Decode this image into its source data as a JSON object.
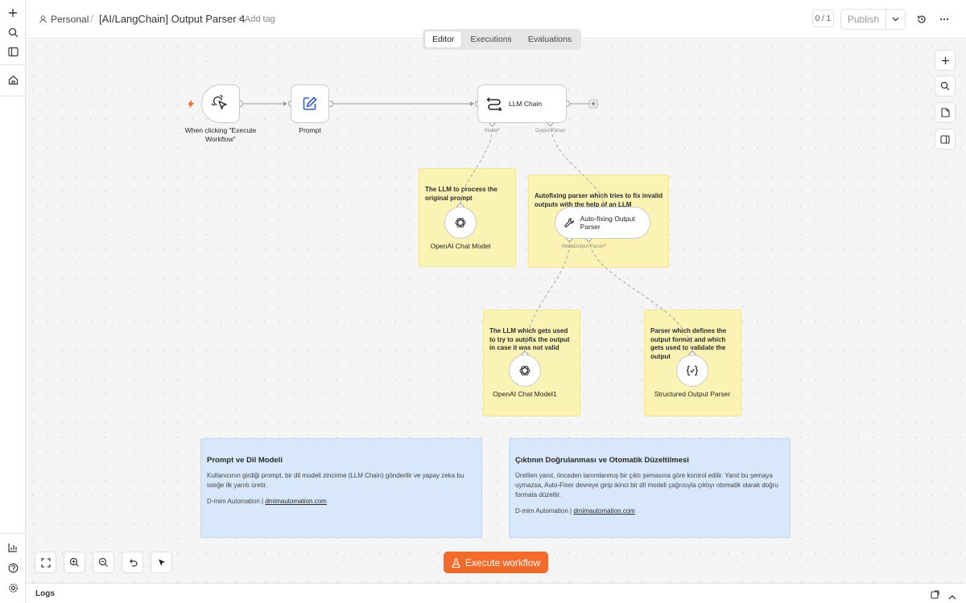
{
  "header": {
    "project": "Personal",
    "separator": "/",
    "workflow_title": "[AI/LangChain] Output Parser 4",
    "add_tag": "+ Add tag",
    "counter": "0 / 1",
    "publish": "Publish"
  },
  "tabs": [
    "Editor",
    "Executions",
    "Evaluations"
  ],
  "nodes": {
    "trigger": "When clicking \"Execute Workflow\"",
    "prompt": "Prompt",
    "llm_chain": "LLM Chain",
    "openai1": "OpenAI Chat Model",
    "autofix": "Auto-fixing Output Parser",
    "openai2": "OpenAI Chat Model1",
    "structured": "Structured Output Parser"
  },
  "handles": {
    "model": "Model",
    "output_parser": "Output Parser",
    "autofix_model": "Model",
    "autofix_output_parser": "Output Parser",
    "required_mark": "*"
  },
  "stickies": {
    "s1": "The LLM to process the original prompt",
    "s2": "Autofixing parser which tries to fix invalid outputs with the help of an LLM",
    "s3": "The LLM which gets used to try to autofix the output in case it was not valid",
    "s4": "Parser which defines the output format and which gets used to validate the output"
  },
  "notes": {
    "left": {
      "title": "Prompt ve Dil Modeli",
      "body": "Kullanıcının girdiği prompt, bir dil modeli zincirine (LLM Chain) gönderilir ve yapay zeka bu isteğe ilk yanıtı üretir.",
      "footer_prefix": "D-mim Automation | ",
      "link": "dmimautomation.com"
    },
    "right": {
      "title": "Çıktının Doğrulanması ve Otomatik Düzeltilmesi",
      "body": "Üretilen yanıt, önceden tanımlanmış bir çıktı şemasına göre kontrol edilir. Yanıt bu şemaya uymazsa, Auto-Fixer devreye girip ikinci bir dil modeli çağrısıyla çıktıyı otomatik olarak doğru formata düzeltir.",
      "footer_prefix": "D-mim Automation | ",
      "link": "dmimautomation.com"
    }
  },
  "execute_button": "Execute workflow",
  "logs_label": "Logs",
  "colors": {
    "accent": "#f26b2a",
    "sticky": "#fbf3b3",
    "note": "#d9e7fb",
    "required": "#e0424d"
  },
  "icons": {
    "rail": [
      "plus-icon",
      "search-icon",
      "sidebar-toggle-icon",
      "home-icon",
      "insights-icon",
      "help-icon",
      "settings-icon"
    ],
    "canvas_right": [
      "add-node-icon",
      "search-node-icon",
      "sticky-note-icon",
      "panel-toggle-icon"
    ],
    "canvas_bottom": [
      "fit-view-icon",
      "zoom-in-icon",
      "zoom-out-icon",
      "undo-icon",
      "select-tool-icon"
    ]
  }
}
